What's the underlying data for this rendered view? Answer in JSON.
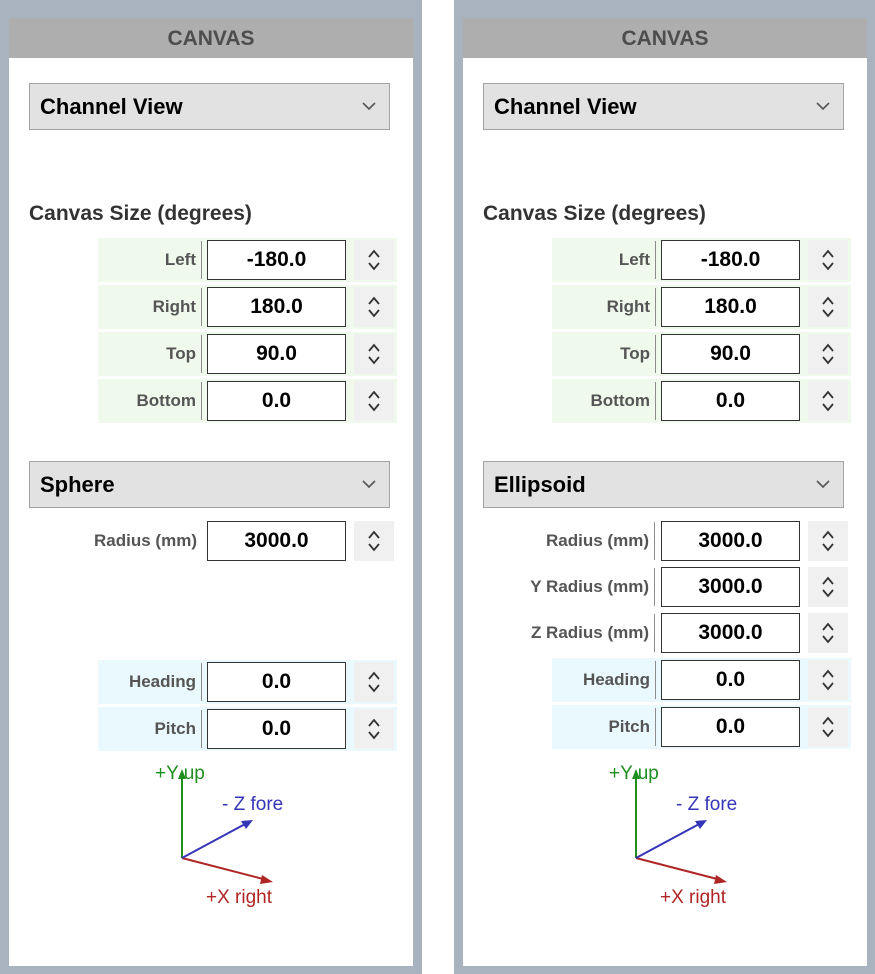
{
  "panels": [
    {
      "header": "CANVAS",
      "view_select": "Channel View",
      "canvas_size": {
        "title": "Canvas Size (degrees)",
        "fields": [
          {
            "label": "Left",
            "value": "-180.0"
          },
          {
            "label": "Right",
            "value": "180.0"
          },
          {
            "label": "Top",
            "value": "90.0"
          },
          {
            "label": "Bottom",
            "value": "0.0"
          }
        ]
      },
      "shape_select": "Sphere",
      "shape_fields": [
        {
          "label": "Radius (mm)",
          "value": "3000.0"
        }
      ],
      "orientation_fields": [
        {
          "label": "Heading",
          "value": "0.0"
        },
        {
          "label": "Pitch",
          "value": "0.0"
        }
      ],
      "axes": {
        "y": "+Y up",
        "z": "- Z fore",
        "x": "+X right"
      }
    },
    {
      "header": "CANVAS",
      "view_select": "Channel View",
      "canvas_size": {
        "title": "Canvas Size (degrees)",
        "fields": [
          {
            "label": "Left",
            "value": "-180.0"
          },
          {
            "label": "Right",
            "value": "180.0"
          },
          {
            "label": "Top",
            "value": "90.0"
          },
          {
            "label": "Bottom",
            "value": "0.0"
          }
        ]
      },
      "shape_select": "Ellipsoid",
      "shape_fields": [
        {
          "label": "Radius (mm)",
          "value": "3000.0"
        },
        {
          "label": "Y Radius (mm)",
          "value": "3000.0"
        },
        {
          "label": "Z Radius (mm)",
          "value": "3000.0"
        }
      ],
      "orientation_fields": [
        {
          "label": "Heading",
          "value": "0.0"
        },
        {
          "label": "Pitch",
          "value": "0.0"
        }
      ],
      "axes": {
        "y": "+Y up",
        "z": "- Z fore",
        "x": "+X right"
      }
    }
  ],
  "colors": {
    "frame": "#a9b2bf",
    "header_bg": "#aeaeae",
    "row_green": "#effaec",
    "row_cyan": "#eaf9fd",
    "axis_y": "#1f8f1f",
    "axis_z": "#3535b8",
    "axis_x": "#b02525"
  }
}
